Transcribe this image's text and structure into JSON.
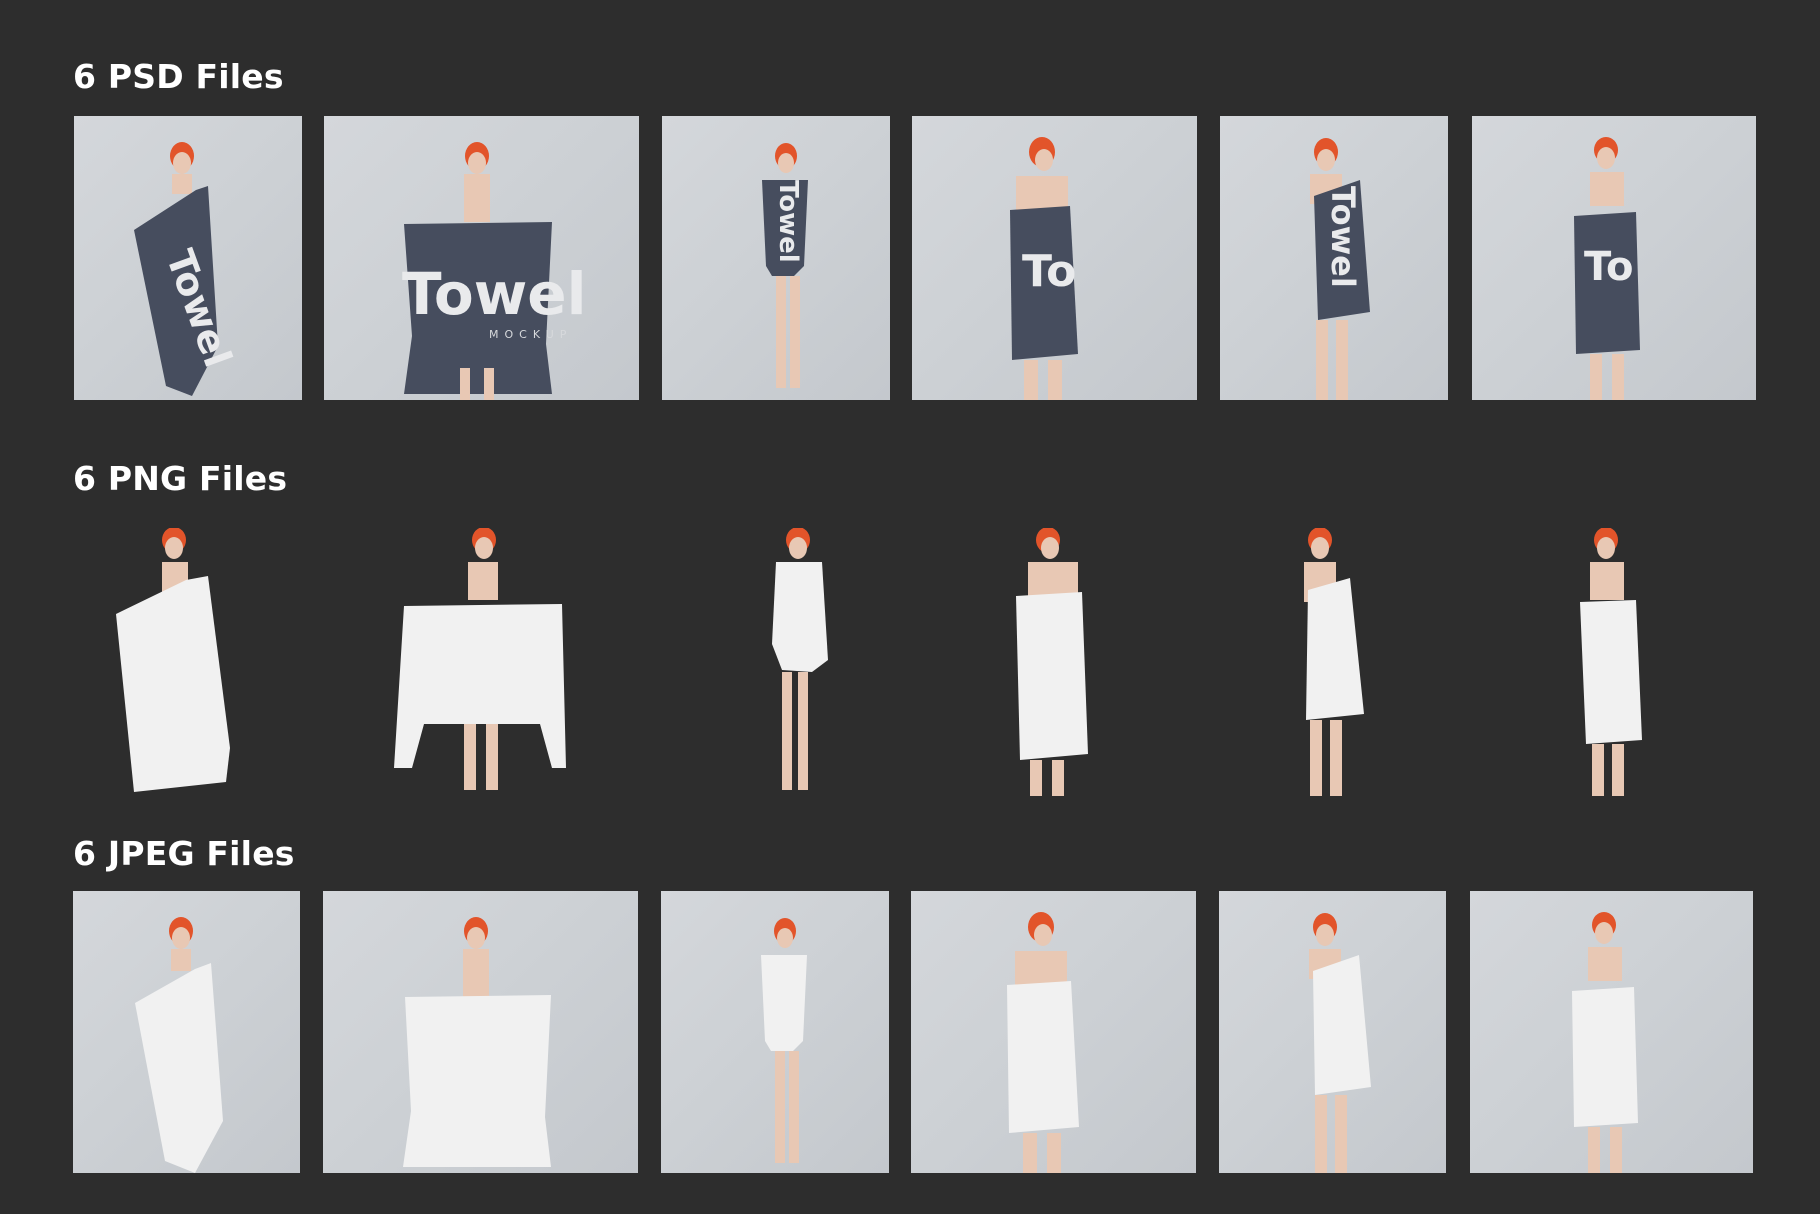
{
  "sections": {
    "psd": {
      "title": "6 PSD Files"
    },
    "png": {
      "title": "6 PNG Files"
    },
    "jpeg": {
      "title": "6 JPEG Files"
    }
  },
  "mockup": {
    "brand_text": "Towel",
    "sub_text": "MOCKUP",
    "towel_color_dark": "#464d5e",
    "towel_color_white": "#f1f1f1",
    "hair_color": "#e2542a",
    "skin_color": "#e8c8b4",
    "background": "#2d2d2d",
    "tile_background": "#cfd3d7"
  }
}
